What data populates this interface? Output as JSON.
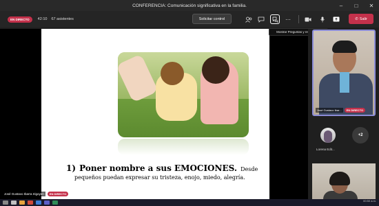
{
  "window": {
    "title": "CONFERENCIA: Comunicación significativa en la familia."
  },
  "meeting": {
    "live_badge": "EN DIRECTO",
    "elapsed": "42:10",
    "attendees": "67 asistentes",
    "request_control": "Solicitar control",
    "leave": "Salir",
    "tooltip": "Mostrar Preguntas y respuestas"
  },
  "slide": {
    "heading_number": "1)",
    "heading_bold": "Poner nombre a sus EMOCIONES.",
    "heading_rest": "Desde",
    "subtext": "pequeños puedan expresar su tristeza, enojo, miedo, alegría."
  },
  "presenter": {
    "name": "José Gustavo Ibarra Irigoyen",
    "live": "EN DIRECTO"
  },
  "participants": {
    "main_cam_name": "José Gustavo Ibar...",
    "main_cam_live": "EN DIRECTO",
    "small_name": "Lorena Edit...",
    "more_count": "+2"
  },
  "taskbar": {
    "time": "00:50 a.m."
  },
  "colors": {
    "live_red": "#c4314b",
    "active_border": "#8b8cd8"
  }
}
